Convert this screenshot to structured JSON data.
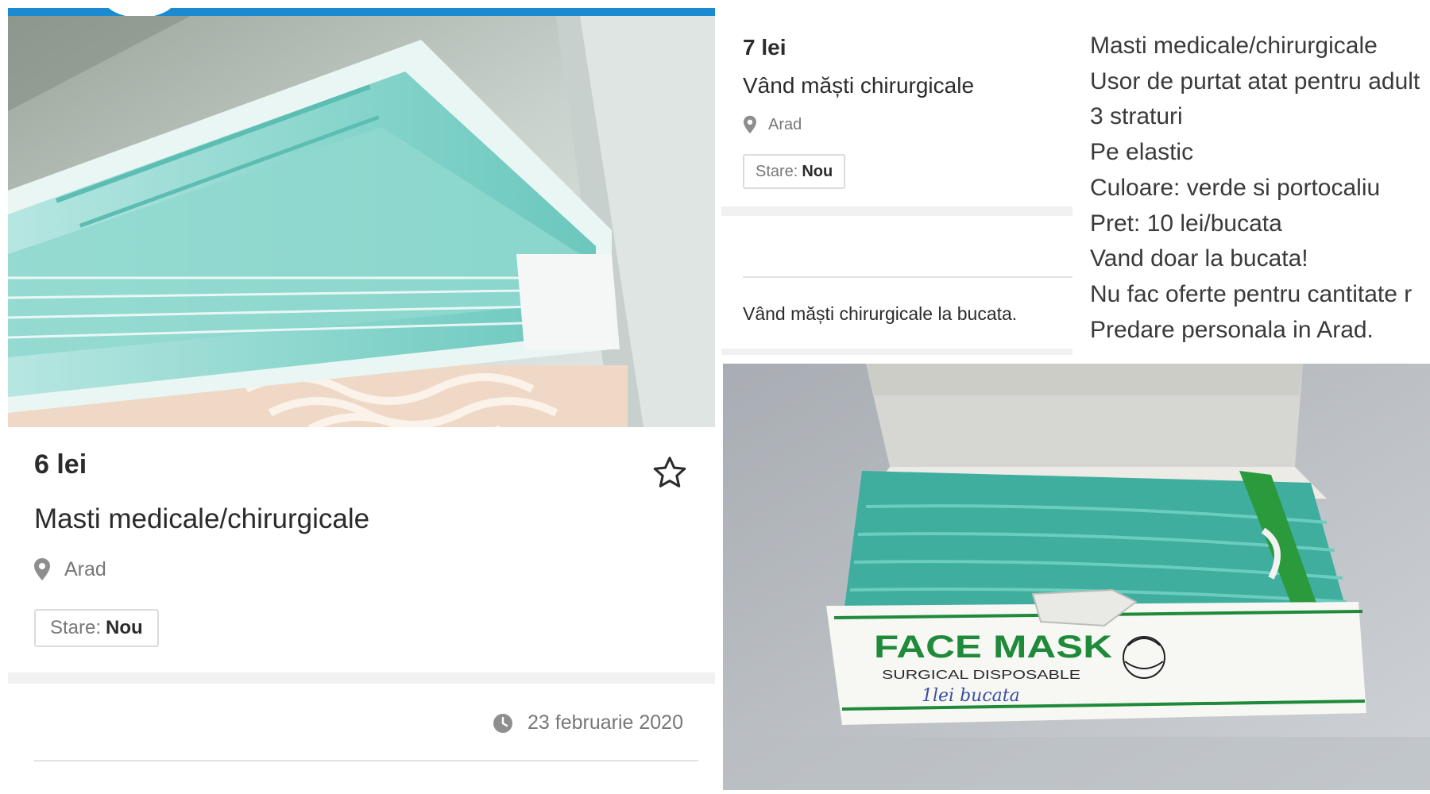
{
  "left_listing": {
    "price": "6 lei",
    "title": "Masti medicale/chirurgicale",
    "location": "Arad",
    "condition_label": "Stare:",
    "condition_value": "Nou",
    "date": "23 februarie 2020",
    "photo_subject": "stack of surgical face masks",
    "icons": [
      "star-icon",
      "location-pin-icon",
      "clock-icon"
    ]
  },
  "right_listing": {
    "price": "7 lei",
    "title": "Vând măști chirurgicale",
    "location": "Arad",
    "condition_label": "Stare:",
    "condition_value": "Nou",
    "description": "Vând măști chirurgicale la bucata."
  },
  "description_lines": [
    "Masti medicale/chirurgicale",
    "Usor de purtat atat pentru adult",
    "3 straturi",
    "Pe elastic",
    "Culoare: verde si portocaliu",
    "Pret: 10 lei/bucata",
    "Vand doar la bucata!",
    "Nu fac oferte pentru cantitate r",
    "Predare personala in Arad."
  ],
  "box_photo": {
    "box_title": "FACE MASK",
    "box_subtitle": "SURGICAL DISPOSABLE",
    "handwriting": "1lei bucata"
  },
  "colors": {
    "accent_bar": "#1a8bd0",
    "mask_teal": "#7fd3cc",
    "box_green": "#1f8a3a"
  }
}
